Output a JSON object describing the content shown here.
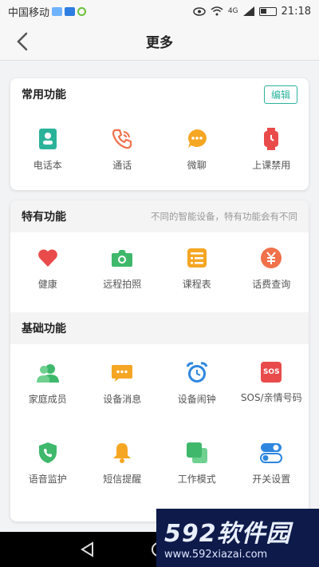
{
  "status": {
    "carrier": "中国移动",
    "network": "4G",
    "time": "21:18"
  },
  "nav": {
    "title": "更多"
  },
  "common": {
    "title": "常用功能",
    "edit_label": "编辑",
    "items": [
      {
        "label": "电话本",
        "icon": "phonebook-icon",
        "color": "#2bb39a"
      },
      {
        "label": "通话",
        "icon": "phone-call-icon",
        "color": "#f0714a"
      },
      {
        "label": "微聊",
        "icon": "chat-bubble-icon",
        "color": "#f5a623"
      },
      {
        "label": "上课禁用",
        "icon": "watch-icon",
        "color": "#e94b4b"
      }
    ]
  },
  "special": {
    "title": "特有功能",
    "note": "不同的智能设备，特有功能会有不同",
    "items": [
      {
        "label": "健康",
        "icon": "heart-icon",
        "color": "#e94b4b"
      },
      {
        "label": "远程拍照",
        "icon": "camera-icon",
        "color": "#3fb86b"
      },
      {
        "label": "课程表",
        "icon": "schedule-icon",
        "color": "#f5a623"
      },
      {
        "label": "话费查询",
        "icon": "yuan-icon",
        "color": "#f0714a"
      }
    ]
  },
  "basic": {
    "title": "基础功能",
    "items": [
      {
        "label": "家庭成员",
        "icon": "family-icon",
        "color": "#3fb86b"
      },
      {
        "label": "设备消息",
        "icon": "message-icon",
        "color": "#f5a623"
      },
      {
        "label": "设备闹钟",
        "icon": "alarm-clock-icon",
        "color": "#2e86de"
      },
      {
        "label": "SOS/亲情号码",
        "icon": "sos-icon",
        "sos_text": "SOS",
        "color": "#e94b4b"
      },
      {
        "label": "语音监护",
        "icon": "shield-phone-icon",
        "color": "#3fb86b"
      },
      {
        "label": "短信提醒",
        "icon": "bell-icon",
        "color": "#f5a623"
      },
      {
        "label": "工作模式",
        "icon": "layers-icon",
        "color": "#3fb86b"
      },
      {
        "label": "开关设置",
        "icon": "toggle-icon",
        "color": "#2e86de"
      }
    ]
  },
  "watermark": {
    "big": "592软件园",
    "small": "www.592xiazai.com"
  }
}
